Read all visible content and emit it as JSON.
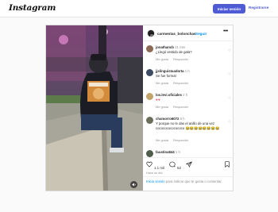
{
  "topbar": {
    "logo": "Instagram",
    "login_button": "Iniciar sesión",
    "signup_link": "Registrarse"
  },
  "post": {
    "author": "carmentas_bolonchas",
    "separator": "•",
    "follow": "Seguir",
    "more": "•••",
    "video_alt": "video thumbnail"
  },
  "comments": [
    {
      "user": "jonathancb",
      "time": "21 min",
      "text": "¿Llegó vestido de gala?",
      "actions": [
        "Me gusta",
        "Responder"
      ]
    },
    {
      "user": "jjslinguistaadorta",
      "time": "1 h",
      "text": "Se fue formal",
      "actions": [
        "Me gusta",
        "Responder"
      ]
    },
    {
      "user": "los.levi.oficiales",
      "time": "2 h",
      "text": "♥♥",
      "actions": [
        "Me gusta",
        "Responder"
      ]
    },
    {
      "user": "chamorro6072",
      "time": "5 h",
      "text": "Y porque no le das el anillo de una vez cocococococococo 😂😂😂😂😂😂😂😂",
      "actions": [
        "Me gusta",
        "Responder"
      ]
    },
    {
      "user": "faustina844",
      "time": "1 h",
      "text": "",
      "actions": []
    }
  ],
  "stats": {
    "likes": "1.1 mil",
    "comments": "52",
    "ago": "Hace un día"
  },
  "login_prompt": {
    "link": "Inicia sesión",
    "rest": " para indicar que te gusta o comentar."
  },
  "colors": {
    "accent": "#4f5bd5",
    "link": "#0095f6",
    "heart": "#ed4956"
  }
}
